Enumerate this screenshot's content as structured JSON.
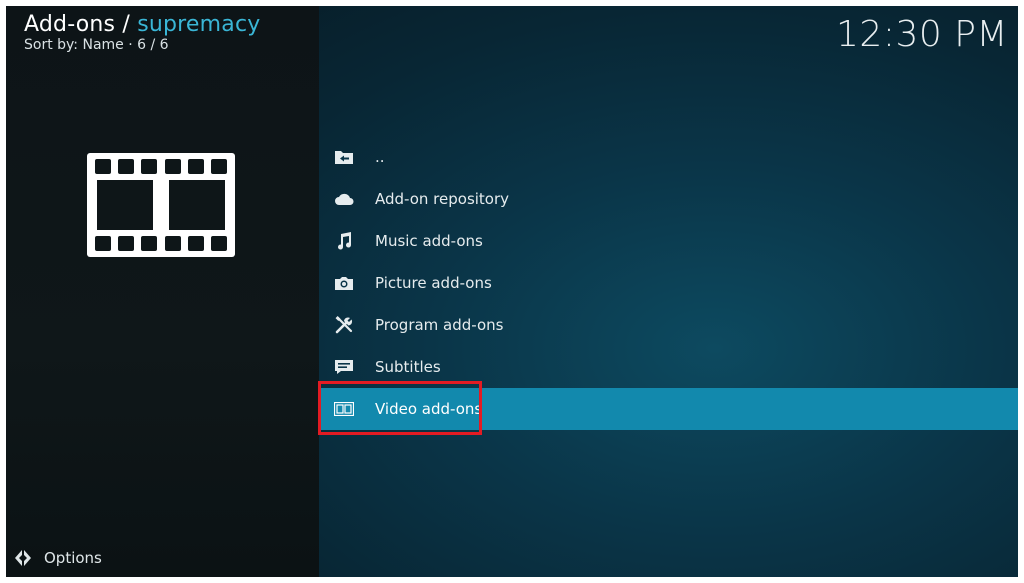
{
  "header": {
    "breadcrumb_prefix": "Add-ons / ",
    "breadcrumb_current": "supremacy",
    "sort_text": "Sort by: Name  ·  6 / 6"
  },
  "clock": "12:30 PM",
  "list": {
    "items": [
      {
        "label": "..",
        "icon": "folder-back-icon"
      },
      {
        "label": "Add-on repository",
        "icon": "cloud-icon"
      },
      {
        "label": "Music add-ons",
        "icon": "music-note-icon"
      },
      {
        "label": "Picture add-ons",
        "icon": "camera-icon"
      },
      {
        "label": "Program add-ons",
        "icon": "tools-icon"
      },
      {
        "label": "Subtitles",
        "icon": "subtitles-icon"
      },
      {
        "label": "Video add-ons",
        "icon": "film-icon",
        "selected": true
      }
    ]
  },
  "footer": {
    "options_label": "Options"
  },
  "colors": {
    "accent": "#3ab6d6",
    "selection": "#1289ad",
    "highlight_border": "#e31b23"
  }
}
